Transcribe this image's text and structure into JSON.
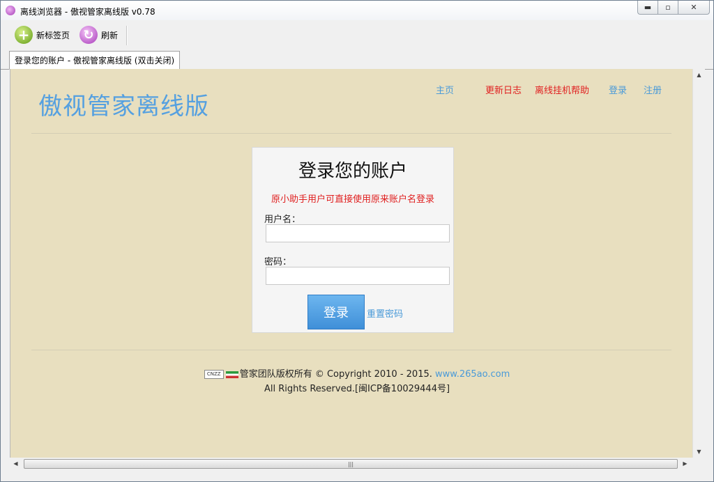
{
  "window": {
    "title": "离线浏览器 - 傲视管家离线版 v0.78",
    "app_icon": "browser-app-icon",
    "controls": {
      "minimize": "▬",
      "maximize": "▫",
      "close": "✕"
    }
  },
  "toolbar": {
    "new_tab_label": "新标签页",
    "refresh_label": "刷新",
    "new_tab_icon": "plus-icon",
    "refresh_icon": "refresh-icon"
  },
  "tabs": [
    {
      "label": "登录您的账户 - 傲视管家离线版 (双击关闭)",
      "active": true
    }
  ],
  "page": {
    "logo": "傲视管家离线版",
    "nav": [
      {
        "label": "主页",
        "color": "#4a9ad8"
      },
      {
        "label": "更新日志",
        "color": "#e02020"
      },
      {
        "label": "离线挂机帮助",
        "color": "#e02020"
      },
      {
        "label": "登录",
        "color": "#4a9ad8"
      },
      {
        "label": "注册",
        "color": "#4a9ad8"
      }
    ],
    "login": {
      "title": "登录您的账户",
      "notice": "原小助手用户可直接使用原来账户名登录",
      "username_label": "用户名：",
      "username_value": "",
      "password_label": "密码：",
      "password_value": "",
      "submit_label": "登录",
      "reset_label": "重置密码"
    },
    "footer": {
      "badge_text": "CNZZ",
      "line1_text": "管家团队版权所有 © Copyright 2010 - 2015.",
      "line1_link": "www.265ao.com",
      "line2": "All Rights Reserved.[闽ICP备10029444号]"
    }
  },
  "colors": {
    "page_bg": "#e8dfbf",
    "accent_blue": "#4a9ad8",
    "accent_red": "#e02020",
    "button_blue": "#3f8fd8"
  }
}
